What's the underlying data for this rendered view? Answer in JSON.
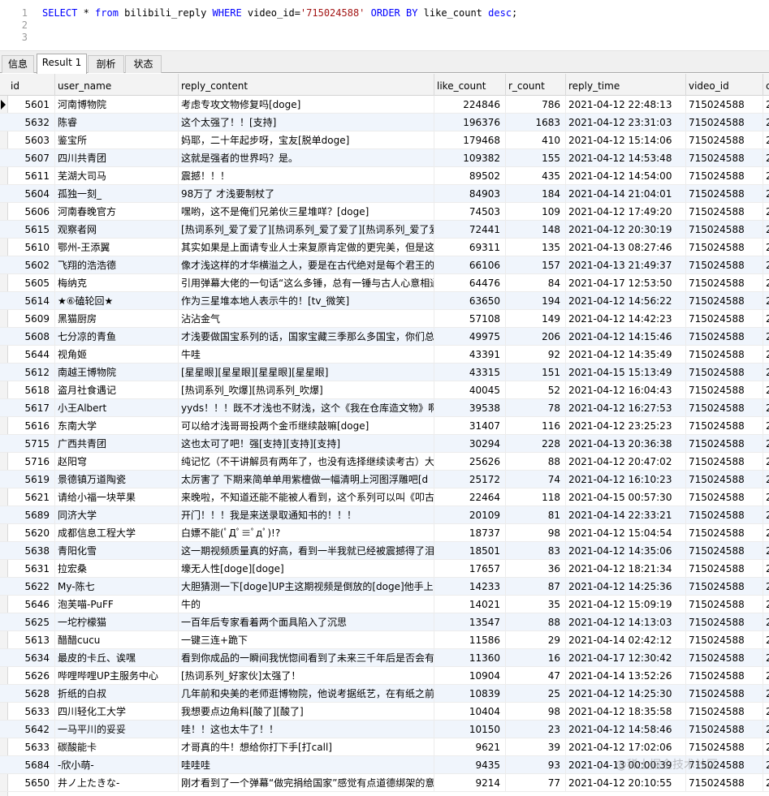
{
  "editor": {
    "lines": [
      {
        "no": "1",
        "parts": [
          {
            "t": "SELECT",
            "k": "kw"
          },
          {
            "t": " * ",
            "k": "plain"
          },
          {
            "t": "from",
            "k": "kw"
          },
          {
            "t": " bilibili_reply ",
            "k": "plain"
          },
          {
            "t": "WHERE",
            "k": "kw"
          },
          {
            "t": " video_id=",
            "k": "plain"
          },
          {
            "t": "'715024588'",
            "k": "str"
          },
          {
            "t": " ",
            "k": "plain"
          },
          {
            "t": "ORDER BY",
            "k": "kw"
          },
          {
            "t": " like_count ",
            "k": "plain"
          },
          {
            "t": "desc",
            "k": "kw"
          },
          {
            "t": ";",
            "k": "plain"
          }
        ]
      },
      {
        "no": "2",
        "parts": []
      },
      {
        "no": "3",
        "parts": []
      }
    ]
  },
  "tabs": [
    {
      "label": "信息",
      "active": false
    },
    {
      "label": "Result 1",
      "active": true
    },
    {
      "label": "剖析",
      "active": false
    },
    {
      "label": "状态",
      "active": false
    }
  ],
  "grid": {
    "columns": [
      "id",
      "user_name",
      "reply_content",
      "like_count",
      "r_count",
      "reply_time",
      "video_id",
      "c"
    ],
    "rows": [
      [
        "5601",
        "河南博物院",
        "考虑专攻文物修复吗[doge]",
        "224846",
        "786",
        "2021-04-12 22:48:13",
        "715024588",
        "2"
      ],
      [
        "5632",
        "陈睿",
        "这个太强了！！[支持]",
        "196376",
        "1683",
        "2021-04-12 23:31:03",
        "715024588",
        "2"
      ],
      [
        "5603",
        "鉴宝所",
        "妈耶，二十年起步呀，宝友[脱单doge]",
        "179468",
        "410",
        "2021-04-12 15:14:06",
        "715024588",
        "2"
      ],
      [
        "5607",
        "四川共青团",
        "这就是强者的世界吗？是。",
        "109382",
        "155",
        "2021-04-12 14:53:48",
        "715024588",
        "2"
      ],
      [
        "5611",
        "芜湖大司马",
        "震撼！！！",
        "89502",
        "435",
        "2021-04-12 14:54:00",
        "715024588",
        "2"
      ],
      [
        "5604",
        "孤独一刻_",
        "98万了  才浅要制杖了",
        "84903",
        "184",
        "2021-04-14 21:04:01",
        "715024588",
        "2"
      ],
      [
        "5606",
        "河南春晚官方",
        "嘿哟，这不是俺们兄弟伙三星堆咩？[doge]",
        "74503",
        "109",
        "2021-04-12 17:49:20",
        "715024588",
        "2"
      ],
      [
        "5615",
        "观察者网",
        "[热词系列_爱了爱了][热词系列_爱了爱了][热词系列_爱了爱了]",
        "72441",
        "148",
        "2021-04-12 20:30:19",
        "715024588",
        "2"
      ],
      [
        "5610",
        "鄂州-王添翼",
        "其实如果是上面请专业人士来复原肯定做的更完美，但是这",
        "69311",
        "135",
        "2021-04-13 08:27:46",
        "715024588",
        "2"
      ],
      [
        "5602",
        "飞翔的浩浩德",
        "像才浅这样的才华横溢之人，要是在古代绝对是每个君王的",
        "66106",
        "157",
        "2021-04-13 21:49:37",
        "715024588",
        "2"
      ],
      [
        "5605",
        "梅纳克",
        "引用弹幕大佬的一句话“这么多锤，总有一锤与古人心意相通",
        "64476",
        "84",
        "2021-04-17 12:53:50",
        "715024588",
        "2"
      ],
      [
        "5614",
        "★⑥磕轮回★",
        "作为三星堆本地人表示牛的！[tv_微笑]",
        "63650",
        "194",
        "2021-04-12 14:56:22",
        "715024588",
        "2"
      ],
      [
        "5609",
        "黑猫厨房",
        "沾沾金气",
        "57108",
        "149",
        "2021-04-12 14:42:23",
        "715024588",
        "2"
      ],
      [
        "5608",
        "七分凉的青鱼",
        "才浅要做国宝系列的话，国家宝藏三季那么多国宝，你们总",
        "49975",
        "206",
        "2021-04-12 14:15:46",
        "715024588",
        "2"
      ],
      [
        "5644",
        "视角姬",
        "牛哇",
        "43391",
        "92",
        "2021-04-12 14:35:49",
        "715024588",
        "2"
      ],
      [
        "5612",
        "南越王博物院",
        "[星星眼][星星眼][星星眼][星星眼]",
        "43315",
        "151",
        "2021-04-15 15:13:49",
        "715024588",
        "2"
      ],
      [
        "5618",
        "盗月社食遇记",
        "[热词系列_吹爆][热词系列_吹爆]",
        "40045",
        "52",
        "2021-04-12 16:04:43",
        "715024588",
        "2"
      ],
      [
        "5617",
        "小王Albert",
        "yyds！！！既不才浅也不财浅，这个《我在仓库造文物》啊",
        "39538",
        "78",
        "2021-04-12 16:27:53",
        "715024588",
        "2"
      ],
      [
        "5616",
        "东南大学",
        "可以给才浅哥哥投两个金币继续敲嘛[doge]",
        "31407",
        "116",
        "2021-04-12 23:25:23",
        "715024588",
        "2"
      ],
      [
        "5715",
        "广西共青团",
        "这也太可了吧！强[支持][支持][支持]",
        "30294",
        "228",
        "2021-04-13 20:36:38",
        "715024588",
        "2"
      ],
      [
        "5716",
        "赵阳穹",
        "纯记忆（不干讲解员有两年了，也没有选择继续读考古）大",
        "25626",
        "88",
        "2021-04-12 20:47:02",
        "715024588",
        "2"
      ],
      [
        "5619",
        "景德镇万道陶瓷",
        "太厉害了 下期来简单单用紫檀做一幅清明上河图浮雕吧[d",
        "25172",
        "74",
        "2021-04-12 16:10:23",
        "715024588",
        "2"
      ],
      [
        "5621",
        "请给小福一块苹果",
        "来晚啦，不知道还能不能被人看到，这个系列可以叫《叩古",
        "22464",
        "118",
        "2021-04-15 00:57:30",
        "715024588",
        "2"
      ],
      [
        "5689",
        "同济大学",
        "开门！！！我是来送录取通知书的！！！",
        "20109",
        "81",
        "2021-04-14 22:33:21",
        "715024588",
        "2"
      ],
      [
        "5620",
        "成都信息工程大学",
        "白嫖不能(ﾟДﾟ≡ﾟдﾟ)!?",
        "18737",
        "98",
        "2021-04-12 15:04:54",
        "715024588",
        "2"
      ],
      [
        "5638",
        "青阳化雪",
        "这一期视频质量真的好高，看到一半我就已经被震撼得了泪",
        "18501",
        "83",
        "2021-04-12 14:35:06",
        "715024588",
        "2"
      ],
      [
        "5631",
        "拉宏桑",
        "壕无人性[doge][doge]",
        "17657",
        "36",
        "2021-04-12 18:21:34",
        "715024588",
        "2"
      ],
      [
        "5622",
        "My-陈七",
        "大胆猜测一下[doge]UP主这期视频是倒放的[doge]他手上把",
        "14233",
        "87",
        "2021-04-12 14:25:36",
        "715024588",
        "2"
      ],
      [
        "5646",
        "泡芙喵-PuFF",
        "牛的",
        "14021",
        "35",
        "2021-04-12 15:09:19",
        "715024588",
        "2"
      ],
      [
        "5625",
        "一坨柠檬猫",
        "一百年后专家看着两个面具陷入了沉思",
        "13547",
        "88",
        "2021-04-12 14:13:03",
        "715024588",
        "2"
      ],
      [
        "5613",
        "醋醋cucu",
        "一键三连+跪下",
        "11586",
        "29",
        "2021-04-14 02:42:12",
        "715024588",
        "2"
      ],
      [
        "5634",
        "最皮的卡丘、诶嘿",
        "看到你成品的一瞬间我恍惚间看到了未来三千年后是否会有",
        "11360",
        "16",
        "2021-04-17 12:30:42",
        "715024588",
        "2"
      ],
      [
        "5626",
        "哔哩哔哩UP主服务中心",
        "[热词系列_好家伙]太强了！",
        "10904",
        "47",
        "2021-04-14 13:52:26",
        "715024588",
        "2"
      ],
      [
        "5628",
        "折纸的白叔",
        "几年前和央美的老师逛博物院，他说考据纸艺，在有纸之前",
        "10839",
        "25",
        "2021-04-12 14:25:30",
        "715024588",
        "2"
      ],
      [
        "5633",
        "四川轻化工大学",
        "我想要点边角料[酸了][酸了]",
        "10404",
        "98",
        "2021-04-12 18:35:58",
        "715024588",
        "2"
      ],
      [
        "5642",
        "一马平川的妥妥",
        "哇！！这也太牛了！！",
        "10150",
        "23",
        "2021-04-12 14:58:46",
        "715024588",
        "2"
      ],
      [
        "5633",
        "碳酸能卡",
        "才哥真的牛！想给你打下手[打call]",
        "9621",
        "39",
        "2021-04-12 17:02:06",
        "715024588",
        "2"
      ],
      [
        "5684",
        "-欣小萌-",
        "哇哇哇",
        "9435",
        "93",
        "2021-04-13 00:00:39",
        "715024588",
        "2"
      ],
      [
        "5650",
        "井ノ上たきな-",
        "刚才看到了一个弹幕“做完捐给国家”感觉有点道德绑架的意思",
        "9214",
        "77",
        "2021-04-12 20:10:55",
        "715024588",
        "2"
      ]
    ]
  },
  "watermark": "@稀土掘金技术社区"
}
